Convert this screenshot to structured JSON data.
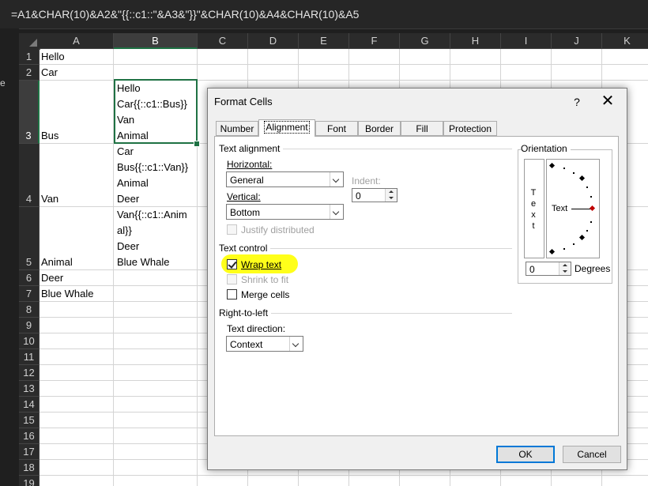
{
  "formula_bar": {
    "text": "=A1&CHAR(10)&A2&\"{{::c1::\"&A3&\"}}\"&CHAR(10)&A4&CHAR(10)&A5"
  },
  "left_strip": {
    "mark": "e"
  },
  "sheet": {
    "columns": [
      "A",
      "B",
      "C",
      "D",
      "E",
      "F",
      "G",
      "H",
      "I",
      "J",
      "K"
    ],
    "selected_column": "B",
    "rows": [
      "1",
      "2",
      "3",
      "4",
      "5",
      "6",
      "7",
      "8",
      "9",
      "10",
      "11",
      "12",
      "13",
      "14",
      "15",
      "16",
      "17",
      "18",
      "19"
    ],
    "selected_row": "3",
    "column_a": [
      "Hello",
      "Car",
      "Bus",
      "Van",
      "Animal",
      "Deer",
      "Blue Whale"
    ],
    "b3_lines": [
      "Hello",
      "Car{{::c1::Bus}}",
      "Van",
      "Animal"
    ],
    "b4_lines": [
      "Car",
      "Bus{{::c1::Van}}",
      "Animal",
      "Deer"
    ],
    "b5_lines": [
      "Van{{::c1::Anim",
      "al}}",
      "Deer",
      "Blue Whale"
    ]
  },
  "dialog": {
    "title": "Format Cells",
    "help": "?",
    "close": "✕",
    "tabs": [
      "Number",
      "Alignment",
      "Font",
      "Border",
      "Fill",
      "Protection"
    ],
    "active_tab": "Alignment",
    "text_alignment": {
      "section": "Text alignment",
      "horizontal_label": "Horizontal:",
      "horizontal_value": "General",
      "indent_label": "Indent:",
      "indent_value": "0",
      "vertical_label": "Vertical:",
      "vertical_value": "Bottom",
      "justify_distributed": "Justify distributed"
    },
    "text_control": {
      "section": "Text control",
      "wrap_text": "Wrap text",
      "wrap_checked": true,
      "shrink_to_fit": "Shrink to fit",
      "merge_cells": "Merge cells"
    },
    "rtl": {
      "section": "Right-to-left",
      "direction_label": "Text direction:",
      "direction_value": "Context"
    },
    "orientation": {
      "section": "Orientation",
      "vertical_text": [
        "T",
        "e",
        "x",
        "t"
      ],
      "dial_text": "Text",
      "degrees_value": "0",
      "degrees_label": "Degrees"
    },
    "ok": "OK",
    "cancel": "Cancel"
  },
  "colors": {
    "selection_green": "#1f7244",
    "highlight_yellow": "#ffff1a",
    "default_button_blue": "#0078d7"
  }
}
